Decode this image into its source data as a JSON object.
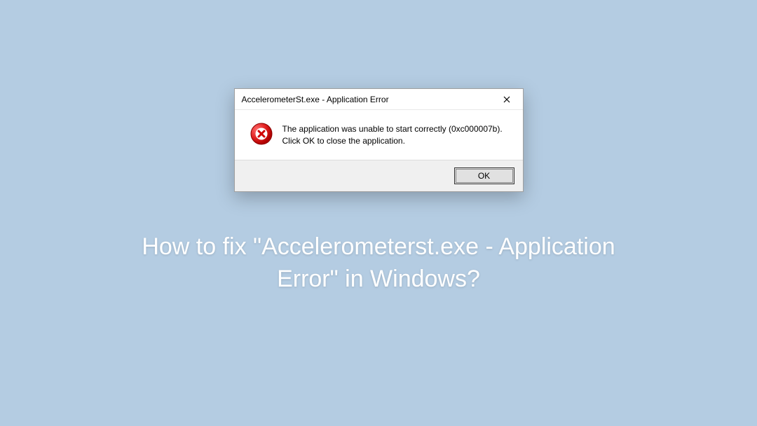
{
  "dialog": {
    "title": "AccelerometerSt.exe - Application Error",
    "message": "The application was unable to start correctly (0xc000007b). Click OK to close the application.",
    "ok_label": "OK"
  },
  "headline": "How to fix \"Accelerometerst.exe - Application Error\" in Windows?"
}
